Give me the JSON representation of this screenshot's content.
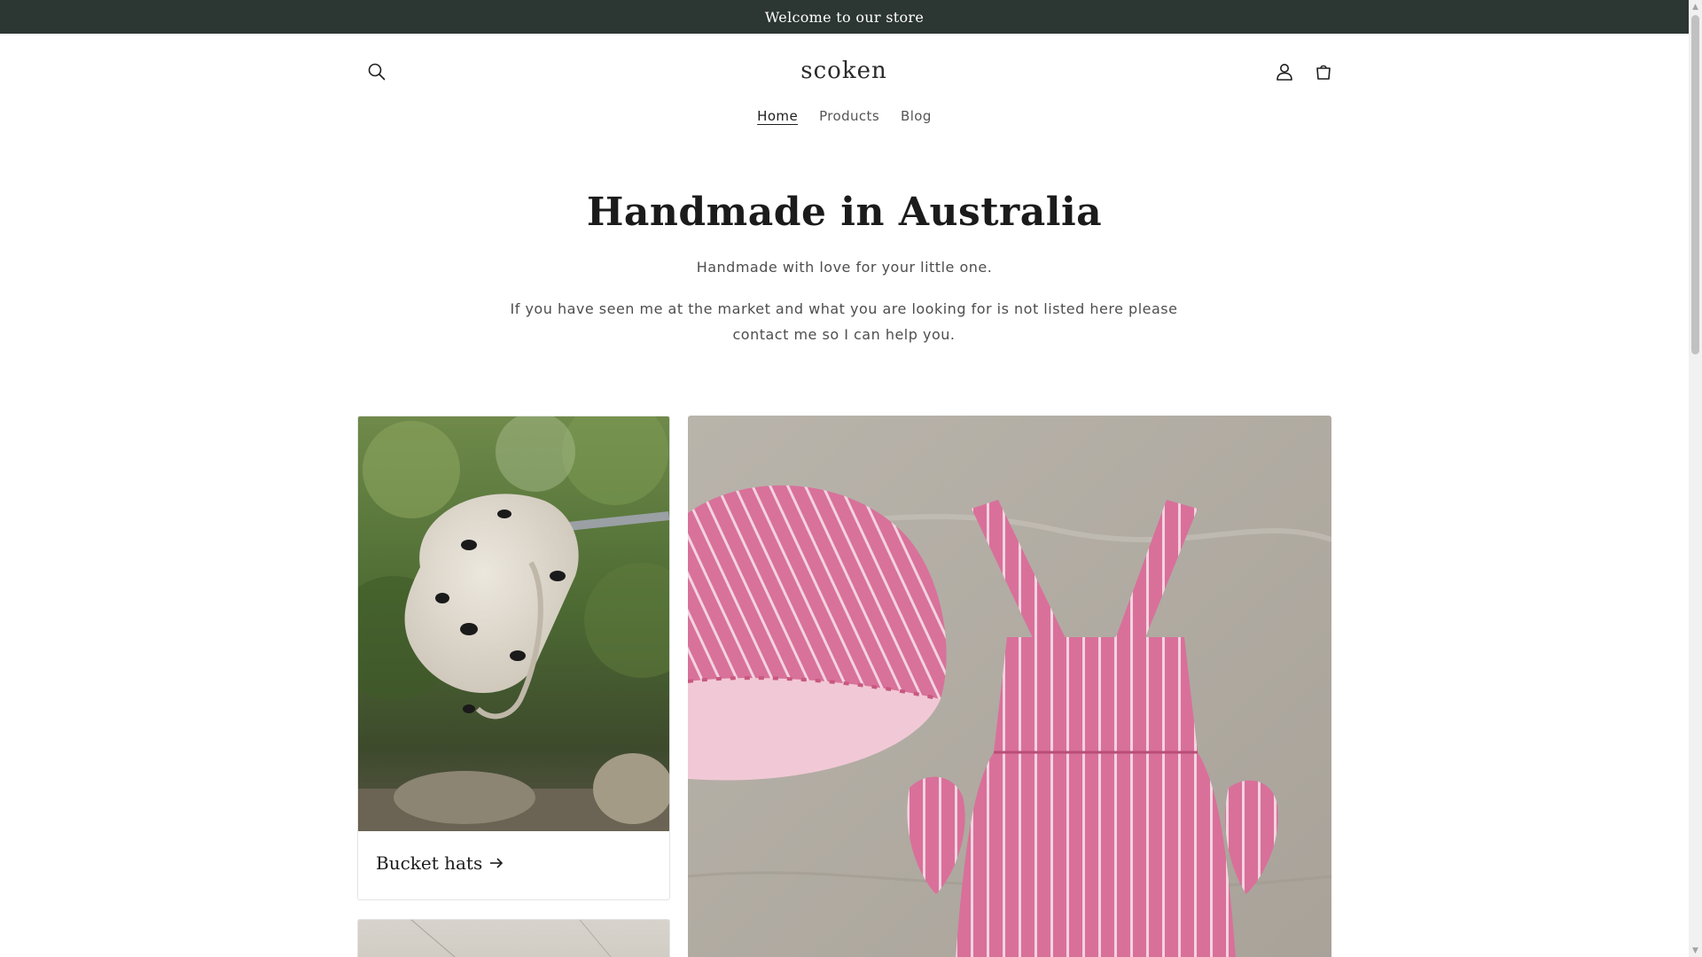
{
  "announcement": {
    "text": "Welcome to our store"
  },
  "header": {
    "logo": "scoken",
    "search_icon": "search-icon",
    "account_icon": "account-icon",
    "cart_icon": "cart-icon"
  },
  "nav": {
    "items": [
      {
        "label": "Home",
        "active": true
      },
      {
        "label": "Products",
        "active": false
      },
      {
        "label": "Blog",
        "active": false
      }
    ]
  },
  "hero": {
    "title": "Handmade in Australia",
    "subtitle": "Handmade with love for your little one.",
    "body": "If you have seen me at the market and what you are looking for is not listed here please contact me so I can help you."
  },
  "collections": [
    {
      "title": "Bucket hats",
      "arrow_icon": "arrow-right-icon",
      "image": "bee-print bucket hat photo"
    },
    {
      "title": "",
      "image": "pink striped overalls and bucket hat photo"
    },
    {
      "title": "",
      "image": "partially visible collection photo"
    }
  ],
  "colors": {
    "announcement_bg": "#2c3632",
    "text": "#121212",
    "muted_text": "#4e4e4e",
    "card_border": "#e4e4e4"
  }
}
